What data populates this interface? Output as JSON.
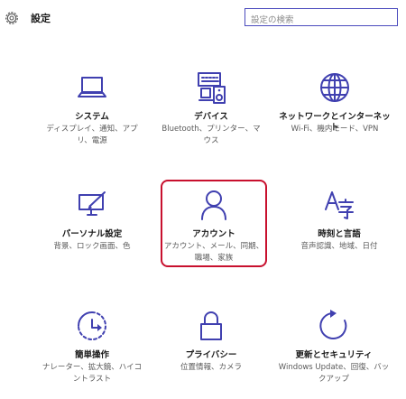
{
  "header": {
    "title": "設定",
    "search_placeholder": "設定の検索",
    "search_value": ""
  },
  "accent_color": "#4040b0",
  "highlight_color": "#c8102e",
  "tiles": [
    {
      "icon": "laptop-icon",
      "label": "システム",
      "desc": "ディスプレイ、通知、アプリ、電源"
    },
    {
      "icon": "devices-icon",
      "label": "デバイス",
      "desc": "Bluetooth、プリンター、マウス"
    },
    {
      "icon": "globe-icon",
      "label": "ネットワークとインターネット",
      "desc": "Wi-Fi、機内モード、VPN"
    },
    {
      "icon": "personalization-icon",
      "label": "パーソナル設定",
      "desc": "背景、ロック画面、色"
    },
    {
      "icon": "person-icon",
      "label": "アカウント",
      "desc": "アカウント、メール、同期、職場、家族"
    },
    {
      "icon": "time-language-icon",
      "label": "時刻と言語",
      "desc": "音声認識、地域、日付"
    },
    {
      "icon": "ease-of-access-icon",
      "label": "簡単操作",
      "desc": "ナレーター、拡大鏡、ハイコントラスト"
    },
    {
      "icon": "lock-icon",
      "label": "プライバシー",
      "desc": "位置情報、カメラ"
    },
    {
      "icon": "update-icon",
      "label": "更新とセキュリティ",
      "desc": "Windows Update、回復、バックアップ"
    }
  ]
}
